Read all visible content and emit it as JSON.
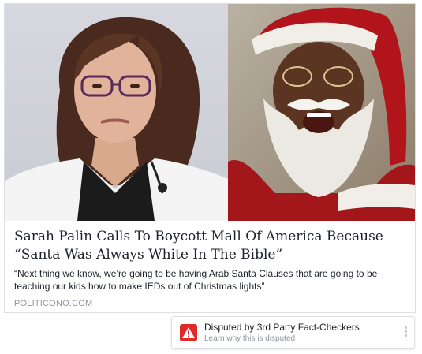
{
  "article": {
    "title": "Sarah Palin Calls To Boycott Mall Of America Because “Santa Was Always White In The Bible”",
    "description": "“Next thing we know, we’re going to be having Arab Santa Clauses that are going to be teaching our kids how to make IEDs out of Christmas lights”",
    "source": "POLITICONO.COM"
  },
  "dispute": {
    "label": "Disputed by 3rd Party Fact-Checkers",
    "sublabel": "Learn why this is disputed",
    "icon": "warning-icon",
    "color": "#e02a2a"
  },
  "icons": {
    "more": "more-options-icon"
  }
}
